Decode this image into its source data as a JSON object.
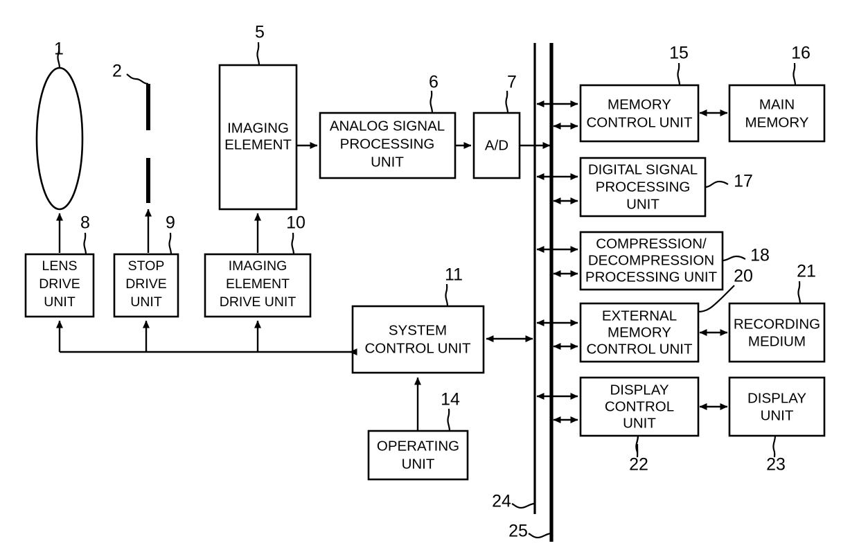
{
  "figure": {
    "title": "Imaging apparatus block diagram",
    "type": "patent-block-diagram"
  },
  "blocks": {
    "lens": {
      "label": "",
      "ref": "1",
      "name": "lens"
    },
    "stop": {
      "label": "",
      "ref": "2",
      "name": "stop"
    },
    "imaging_element": {
      "line1": "IMAGING",
      "line2": "ELEMENT",
      "ref": "5"
    },
    "analog_signal": {
      "line1": "ANALOG SIGNAL",
      "line2": "PROCESSING",
      "line3": "UNIT",
      "ref": "6"
    },
    "ad": {
      "line1": "A/D",
      "ref": "7"
    },
    "lens_drive": {
      "line1": "LENS",
      "line2": "DRIVE",
      "line3": "UNIT",
      "ref": "8"
    },
    "stop_drive": {
      "line1": "STOP",
      "line2": "DRIVE",
      "line3": "UNIT",
      "ref": "9"
    },
    "imaging_element_drive": {
      "line1": "IMAGING",
      "line2": "ELEMENT",
      "line3": "DRIVE UNIT",
      "ref": "10"
    },
    "system_control": {
      "line1": "SYSTEM",
      "line2": "CONTROL UNIT",
      "ref": "11"
    },
    "operating": {
      "line1": "OPERATING",
      "line2": "UNIT",
      "ref": "14"
    },
    "memory_control": {
      "line1": "MEMORY",
      "line2": "CONTROL UNIT",
      "ref": "15"
    },
    "main_memory": {
      "line1": "MAIN",
      "line2": "MEMORY",
      "ref": "16"
    },
    "digital_signal": {
      "line1": "DIGITAL SIGNAL",
      "line2": "PROCESSING",
      "line3": "UNIT",
      "ref": "17"
    },
    "compression": {
      "line1": "COMPRESSION/",
      "line2": "DECOMPRESSION",
      "line3": "PROCESSING UNIT",
      "ref": "18"
    },
    "external_memory_control": {
      "line1": "EXTERNAL",
      "line2": "MEMORY",
      "line3": "CONTROL UNIT",
      "ref": "20"
    },
    "recording_medium": {
      "line1": "RECORDING",
      "line2": "MEDIUM",
      "ref": "21"
    },
    "display_control": {
      "line1": "DISPLAY",
      "line2": "CONTROL",
      "line3": "UNIT",
      "ref": "22"
    },
    "display_unit": {
      "line1": "DISPLAY",
      "line2": "UNIT",
      "ref": "23"
    }
  },
  "buses": {
    "control_bus": {
      "ref": "24"
    },
    "data_bus": {
      "ref": "25"
    }
  },
  "colors": {
    "stroke": "#000000",
    "fill": "#ffffff"
  }
}
